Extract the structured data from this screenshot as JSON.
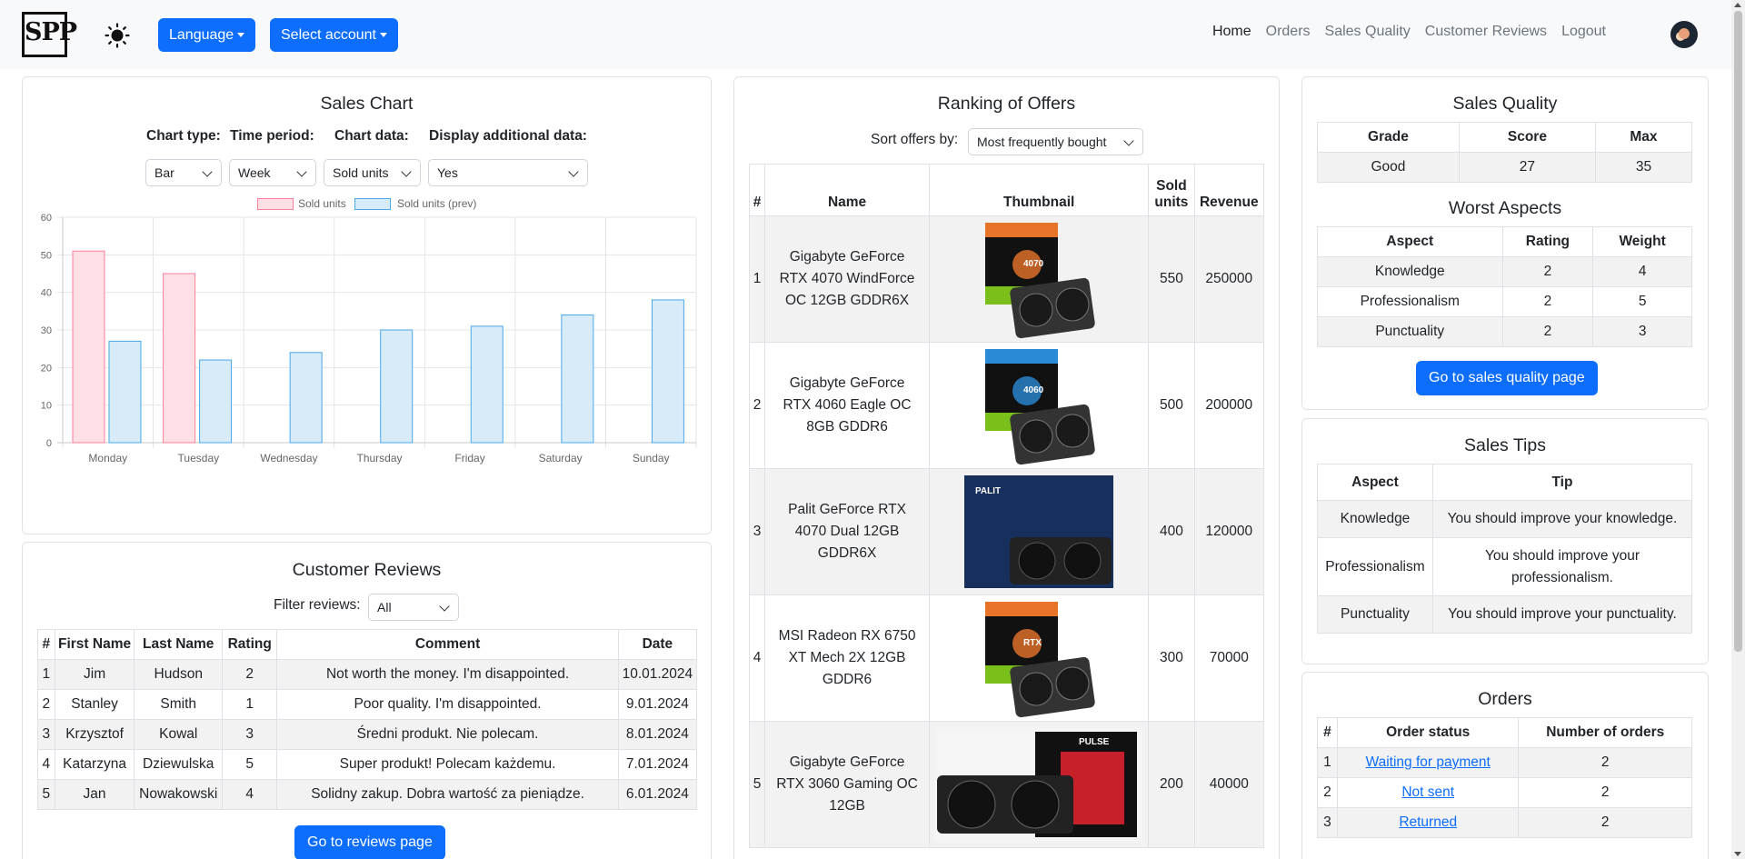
{
  "navbar": {
    "logo": "SPP",
    "language_label": "Language",
    "account_label": "Select account",
    "links": [
      {
        "label": "Home",
        "active": true
      },
      {
        "label": "Orders",
        "active": false
      },
      {
        "label": "Sales Quality",
        "active": false
      },
      {
        "label": "Customer Reviews",
        "active": false
      },
      {
        "label": "Logout",
        "active": false
      }
    ]
  },
  "sales_chart": {
    "title": "Sales Chart",
    "controls": {
      "chart_type_label": "Chart type:",
      "time_period_label": "Time period:",
      "chart_data_label": "Chart data:",
      "additional_label": "Display additional data:",
      "chart_type_value": "Bar",
      "time_period_value": "Week",
      "chart_data_value": "Sold units",
      "additional_value": "Yes"
    }
  },
  "chart_data": {
    "type": "bar",
    "categories": [
      "Monday",
      "Tuesday",
      "Wednesday",
      "Thursday",
      "Friday",
      "Saturday",
      "Sunday"
    ],
    "series": [
      {
        "name": "Sold units",
        "values": [
          51,
          45,
          0,
          0,
          0,
          0,
          0
        ],
        "fill": "#ffe0e6",
        "stroke": "#ff7d99"
      },
      {
        "name": "Sold units (prev)",
        "values": [
          27,
          22,
          24,
          30,
          31,
          34,
          38
        ],
        "fill": "#d7ebf9",
        "stroke": "#4aa8e8"
      }
    ],
    "ylim": [
      0,
      60
    ],
    "yticks": [
      0,
      10,
      20,
      30,
      40,
      50,
      60
    ],
    "grid": true,
    "legend": "top-center"
  },
  "reviews": {
    "title": "Customer Reviews",
    "filter_label": "Filter reviews:",
    "filter_value": "All",
    "headers": [
      "#",
      "First Name",
      "Last Name",
      "Rating",
      "Comment",
      "Date"
    ],
    "rows": [
      [
        "1",
        "Jim",
        "Hudson",
        "2",
        "Not worth the money. I'm disappointed.",
        "10.01.2024"
      ],
      [
        "2",
        "Stanley",
        "Smith",
        "1",
        "Poor quality. I'm disappointed.",
        "9.01.2024"
      ],
      [
        "3",
        "Krzysztof",
        "Kowal",
        "3",
        "Średni produkt. Nie polecam.",
        "8.01.2024"
      ],
      [
        "4",
        "Katarzyna",
        "Dziewulska",
        "5",
        "Super produkt! Polecam każdemu.",
        "7.01.2024"
      ],
      [
        "5",
        "Jan",
        "Nowakowski",
        "4",
        "Solidny zakup. Dobra wartość za pieniądze.",
        "6.01.2024"
      ]
    ],
    "button_label": "Go to reviews page"
  },
  "ranking": {
    "title": "Ranking of Offers",
    "sort_label": "Sort offers by:",
    "sort_value": "Most frequently bought",
    "headers": [
      "#",
      "Name",
      "Thumbnail",
      "Sold units",
      "Revenue"
    ],
    "rows": [
      {
        "n": "1",
        "name": "Gigabyte GeForce RTX 4070 WindForce OC 12GB GDDR6X",
        "sold": "550",
        "revenue": "250000",
        "thumb_label": "4070",
        "accent": "#e8742a"
      },
      {
        "n": "2",
        "name": "Gigabyte GeForce RTX 4060 Eagle OC 8GB GDDR6",
        "sold": "500",
        "revenue": "200000",
        "thumb_label": "4060",
        "accent": "#2a8ad6"
      },
      {
        "n": "3",
        "name": "Palit GeForce RTX 4070 Dual 12GB GDDR6X",
        "sold": "400",
        "revenue": "120000",
        "thumb_label": "PALIT",
        "accent": "#1e3e78"
      },
      {
        "n": "4",
        "name": "MSI Radeon RX 6750 XT Mech 2X 12GB GDDR6",
        "sold": "300",
        "revenue": "70000",
        "thumb_label": "RTX",
        "accent": "#e8742a"
      },
      {
        "n": "5",
        "name": "Gigabyte GeForce RTX 3060 Gaming OC 12GB",
        "sold": "200",
        "revenue": "40000",
        "thumb_label": "PULSE",
        "accent": "#c8202a"
      }
    ]
  },
  "sales_quality": {
    "title": "Sales Quality",
    "headers": [
      "Grade",
      "Score",
      "Max"
    ],
    "row": [
      "Good",
      "27",
      "35"
    ],
    "worst_title": "Worst Aspects",
    "worst_headers": [
      "Aspect",
      "Rating",
      "Weight"
    ],
    "worst_rows": [
      [
        "Knowledge",
        "2",
        "4"
      ],
      [
        "Professionalism",
        "2",
        "5"
      ],
      [
        "Punctuality",
        "2",
        "3"
      ]
    ],
    "button_label": "Go to sales quality page"
  },
  "sales_tips": {
    "title": "Sales Tips",
    "headers": [
      "Aspect",
      "Tip"
    ],
    "rows": [
      [
        "Knowledge",
        "You should improve your knowledge."
      ],
      [
        "Professionalism",
        "You should improve your professionalism."
      ],
      [
        "Punctuality",
        "You should improve your punctuality."
      ]
    ]
  },
  "orders": {
    "title": "Orders",
    "headers": [
      "#",
      "Order status",
      "Number of orders"
    ],
    "rows": [
      [
        "1",
        "Waiting for payment",
        "2"
      ],
      [
        "2",
        "Not sent",
        "2"
      ],
      [
        "3",
        "Returned",
        "2"
      ]
    ]
  }
}
